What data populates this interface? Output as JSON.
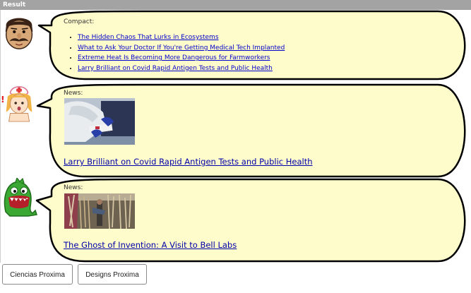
{
  "window": {
    "title": "Result"
  },
  "feed": [
    {
      "label": "Compact:",
      "links": [
        "The Hidden Chaos That Lurks in Ecosystems",
        "What to Ask Your Doctor If You're Getting Medical Tech Implanted",
        "Extreme Heat Is Becoming More Dangerous for Farmworkers",
        "Larry Brilliant on Covid Rapid Antigen Tests and Public Health"
      ]
    },
    {
      "label": "News:",
      "headline": "Larry Brilliant on Covid Rapid Antigen Tests and Public Health"
    },
    {
      "label": "News:",
      "headline": "The Ghost of Invention: A Visit to Bell Labs"
    }
  ],
  "buttons": {
    "first": "Ciencias Proxima",
    "second": "Designs Proxima"
  },
  "colors": {
    "bubble_fill": "#fffccb",
    "bubble_stroke": "#000000",
    "link": "#0000cc",
    "titlebar": "#a3a3a3"
  },
  "icons": {
    "avatar1": "mustache-man-icon",
    "avatar2": "nurse-icon",
    "avatar3": "green-monster-icon"
  }
}
